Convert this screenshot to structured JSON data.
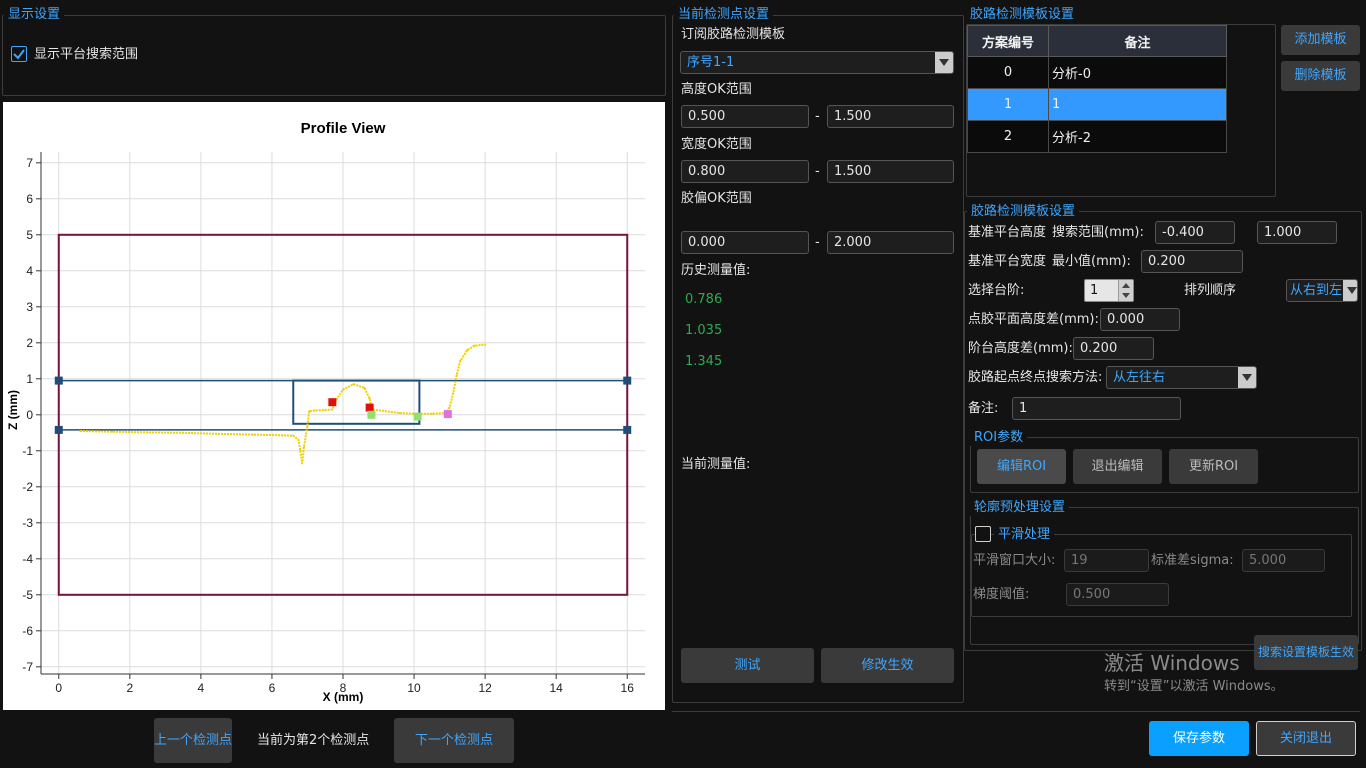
{
  "display_settings": {
    "title": "显示设置",
    "show_platform_label": "显示平台搜索范围",
    "show_platform_checked": true
  },
  "chart": {
    "title": "Profile View",
    "xlabel": "X (mm)",
    "ylabel": "Z (mm)"
  },
  "chart_data": {
    "type": "scatter",
    "title": "Profile View",
    "xlabel": "X (mm)",
    "ylabel": "Z (mm)",
    "xlim": [
      -0.5,
      16.5
    ],
    "ylim": [
      -7.2,
      7.3
    ],
    "x_ticks": [
      0,
      2,
      4,
      6,
      8,
      10,
      12,
      14,
      16
    ],
    "y_ticks": [
      7,
      6,
      5,
      4,
      3,
      2,
      1,
      0,
      -1,
      -2,
      -3,
      -4,
      -5,
      -6,
      -7
    ],
    "grid": true,
    "profile": {
      "color": "#f0d000",
      "points": [
        [
          0.6,
          -0.45
        ],
        [
          1.5,
          -0.47
        ],
        [
          2.5,
          -0.49
        ],
        [
          3.5,
          -0.5
        ],
        [
          4.5,
          -0.53
        ],
        [
          5.5,
          -0.55
        ],
        [
          6.3,
          -0.57
        ],
        [
          6.6,
          -0.58
        ],
        [
          6.75,
          -0.7
        ],
        [
          6.8,
          -1.0
        ],
        [
          6.85,
          -1.35
        ],
        [
          6.9,
          -0.9
        ],
        [
          7.0,
          -0.3
        ],
        [
          7.05,
          0.1
        ],
        [
          7.2,
          0.12
        ],
        [
          7.5,
          0.13
        ],
        [
          7.7,
          0.15
        ],
        [
          7.8,
          0.4
        ],
        [
          8.0,
          0.7
        ],
        [
          8.3,
          0.85
        ],
        [
          8.6,
          0.75
        ],
        [
          8.75,
          0.45
        ],
        [
          8.8,
          0.15
        ],
        [
          9.2,
          0.1
        ],
        [
          9.6,
          0.05
        ],
        [
          10.0,
          0.03
        ],
        [
          10.5,
          0.03
        ],
        [
          10.9,
          0.05
        ],
        [
          11.0,
          0.2
        ],
        [
          11.1,
          0.6
        ],
        [
          11.2,
          1.1
        ],
        [
          11.3,
          1.5
        ],
        [
          11.5,
          1.8
        ],
        [
          11.7,
          1.92
        ],
        [
          12.0,
          1.95
        ]
      ]
    },
    "search_range_box": {
      "x": [
        0,
        16
      ],
      "z": [
        -5,
        5
      ],
      "color": "#7a1040"
    },
    "platform_lines": {
      "z": [
        0.95,
        -0.42
      ],
      "x": [
        0,
        16
      ],
      "color": "#1f4e79"
    },
    "roi_box": {
      "x": [
        6.6,
        10.15
      ],
      "z": [
        -0.25,
        0.95
      ],
      "color": "#1f4e79"
    },
    "markers": [
      {
        "x": 7.7,
        "z": 0.35,
        "color": "#e01010"
      },
      {
        "x": 8.75,
        "z": 0.2,
        "color": "#e01010"
      },
      {
        "x": 8.8,
        "z": 0.0,
        "color": "#90e070"
      },
      {
        "x": 10.1,
        "z": -0.05,
        "color": "#90e070"
      },
      {
        "x": 10.95,
        "z": 0.02,
        "color": "#e070e0"
      }
    ]
  },
  "nav": {
    "prev_label": "上一个检测点",
    "status": "当前为第2个检测点",
    "next_label": "下一个检测点"
  },
  "current_point": {
    "title": "当前检测点设置",
    "subscribe_label": "订阅胶路检测模板",
    "subscribe_value": "序号1-1",
    "height_label": "高度OK范围",
    "height_min": "0.500",
    "height_max": "1.500",
    "width_label": "宽度OK范围",
    "width_min": "0.800",
    "width_max": "1.500",
    "offset_label": "胶偏OK范围",
    "offset_min": "0.000",
    "offset_max": "2.000",
    "dash": "-",
    "history_label": "历史测量值:",
    "history": [
      "0.786",
      "1.035",
      "1.345"
    ],
    "current_label": "当前测量值:",
    "test_label": "测试",
    "apply_label": "修改生效"
  },
  "template_settings": {
    "title": "胶路检测模板设置",
    "col_id": "方案编号",
    "col_note": "备注",
    "rows": [
      {
        "id": "0",
        "note": "分析-0"
      },
      {
        "id": "1",
        "note": "1"
      },
      {
        "id": "2",
        "note": "分析-2"
      }
    ],
    "add_label": "添加模板",
    "delete_label": "删除模板",
    "sub_title": "胶路检测模板设置",
    "base_height_label": "基准平台高度",
    "search_range_label": "搜索范围(mm):",
    "search_min": "-0.400",
    "search_max": "1.000",
    "base_width_label": "基准平台宽度",
    "min_label": "最小值(mm):",
    "min_value": "0.200",
    "step_label": "选择台阶:",
    "step_value": "1",
    "order_label": "排列顺序",
    "order_value": "从右到左",
    "dot_height_label": "点胶平面高度差(mm):",
    "dot_height_value": "0.000",
    "step_height_label": "阶台高度差(mm):",
    "step_height_value": "0.200",
    "search_method_label": "胶路起点终点搜索方法:",
    "search_method_value": "从左往右",
    "note_label": "备注:",
    "note_value": "1"
  },
  "roi": {
    "title": "ROI参数",
    "edit_label": "编辑ROI",
    "exit_label": "退出编辑",
    "update_label": "更新ROI"
  },
  "preprocess": {
    "title": "轮廓预处理设置",
    "smooth_label": "平滑处理",
    "smooth_checked": false,
    "window_label": "平滑窗口大小:",
    "window_value": "19",
    "sigma_label": "标准差sigma:",
    "sigma_value": "5.000",
    "grad_label": "梯度阈值:",
    "grad_value": "0.500"
  },
  "search_apply_label": "搜索设置模板生效",
  "watermark": {
    "line1": "激活 Windows",
    "line2": "转到“设置”以激活 Windows。"
  },
  "footer": {
    "save_label": "保存参数",
    "close_label": "关闭退出"
  }
}
